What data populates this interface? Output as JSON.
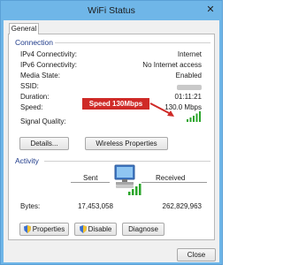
{
  "window": {
    "title": "WiFi Status",
    "close_glyph": "✕"
  },
  "tabs": [
    {
      "label": "General"
    }
  ],
  "connection": {
    "heading": "Connection",
    "rows": [
      {
        "label": "IPv4 Connectivity:",
        "value": "Internet"
      },
      {
        "label": "IPv6 Connectivity:",
        "value": "No Internet access"
      },
      {
        "label": "Media State:",
        "value": "Enabled"
      },
      {
        "label": "SSID:",
        "value": ""
      },
      {
        "label": "Duration:",
        "value": "01:11:21"
      },
      {
        "label": "Speed:",
        "value": "130.0 Mbps"
      }
    ],
    "signal_label": "Signal Quality:",
    "signal_bars_filled": 5,
    "signal_bars_total": 5,
    "details_button": "Details...",
    "wireless_button": "Wireless Properties"
  },
  "annotation": {
    "text": "Speed 130Mbps",
    "color": "#cf2a27"
  },
  "activity": {
    "heading": "Activity",
    "sent_label": "Sent",
    "received_label": "Received",
    "bytes_label": "Bytes:",
    "bytes_sent": "17,453,058",
    "bytes_received": "262,829,963",
    "icon": "network-computer-icon"
  },
  "buttons": {
    "properties": "Properties",
    "disable": "Disable",
    "diagnose": "Diagnose",
    "close": "Close"
  },
  "colors": {
    "titlebar": "#6fb6e8",
    "group_heading": "#1f3b8a",
    "signal_green": "#2aa52a"
  }
}
